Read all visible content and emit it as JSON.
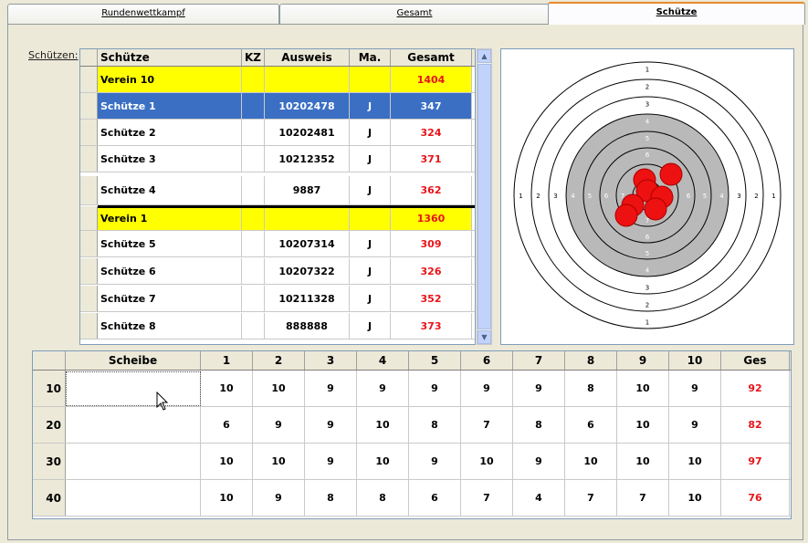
{
  "tabs": [
    {
      "label": "Rundenwettkampf",
      "active": false
    },
    {
      "label": "Gesamt",
      "active": false
    },
    {
      "label": "Schütze",
      "active": true
    }
  ],
  "label_schuetzen": "Schützen:",
  "shooters_table": {
    "headers": {
      "name": "Schütze",
      "kz": "KZ",
      "ausweis": "Ausweis",
      "ma": "Ma.",
      "gesamt": "Gesamt"
    },
    "rows": [
      {
        "name": "Verein 10",
        "kz": "",
        "ausweis": "",
        "ma": "",
        "gesamt": "1404",
        "type": "club"
      },
      {
        "name": "Schütze 1",
        "kz": "",
        "ausweis": "10202478",
        "ma": "J",
        "gesamt": "347",
        "type": "selected"
      },
      {
        "name": "Schütze 2",
        "kz": "",
        "ausweis": "10202481",
        "ma": "J",
        "gesamt": "324",
        "type": "normal"
      },
      {
        "name": "Schütze 3",
        "kz": "",
        "ausweis": "10212352",
        "ma": "J",
        "gesamt": "371",
        "type": "normal"
      },
      {
        "name": "Schütze 4",
        "kz": "",
        "ausweis": "9887",
        "ma": "J",
        "gesamt": "362",
        "type": "normal"
      },
      {
        "name": "Verein 1",
        "kz": "",
        "ausweis": "",
        "ma": "",
        "gesamt": "1360",
        "type": "club"
      },
      {
        "name": "Schütze 5",
        "kz": "",
        "ausweis": "10207314",
        "ma": "J",
        "gesamt": "309",
        "type": "normal"
      },
      {
        "name": "Schütze 6",
        "kz": "",
        "ausweis": "10207322",
        "ma": "J",
        "gesamt": "326",
        "type": "normal"
      },
      {
        "name": "Schütze 7",
        "kz": "",
        "ausweis": "10211328",
        "ma": "J",
        "gesamt": "352",
        "type": "normal"
      },
      {
        "name": "Schütze 8",
        "kz": "",
        "ausweis": "888888",
        "ma": "J",
        "gesamt": "373",
        "type": "normal"
      }
    ]
  },
  "target": {
    "ring_numbers": [
      "1",
      "2",
      "3",
      "4",
      "5",
      "6",
      "7",
      "8"
    ],
    "hit_color": "#ee1111"
  },
  "scores_table": {
    "headers": [
      "Scheibe",
      "1",
      "2",
      "3",
      "4",
      "5",
      "6",
      "7",
      "8",
      "9",
      "10",
      "Ges"
    ],
    "rows": [
      {
        "label": "10",
        "scheibe": "",
        "shots": [
          "10",
          "10",
          "9",
          "9",
          "9",
          "9",
          "9",
          "8",
          "10",
          "9"
        ],
        "ges": "92"
      },
      {
        "label": "20",
        "scheibe": "",
        "shots": [
          "6",
          "9",
          "9",
          "10",
          "8",
          "7",
          "8",
          "6",
          "10",
          "9"
        ],
        "ges": "82"
      },
      {
        "label": "30",
        "scheibe": "",
        "shots": [
          "10",
          "10",
          "9",
          "10",
          "9",
          "10",
          "9",
          "10",
          "10",
          "10"
        ],
        "ges": "97"
      },
      {
        "label": "40",
        "scheibe": "",
        "shots": [
          "10",
          "9",
          "8",
          "8",
          "6",
          "7",
          "4",
          "7",
          "7",
          "10"
        ],
        "ges": "76"
      }
    ]
  },
  "colors": {
    "selected_row": "#3a6fc4",
    "club_row": "#ffff00",
    "total_text": "#e8141a"
  }
}
